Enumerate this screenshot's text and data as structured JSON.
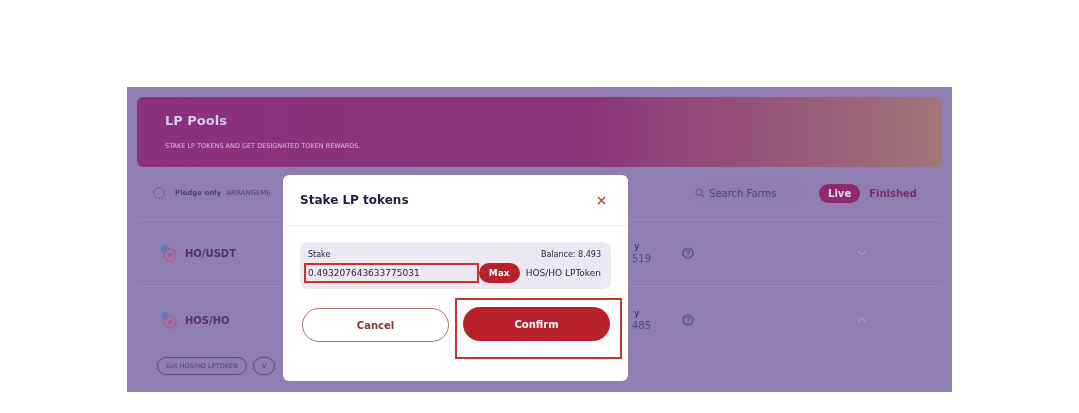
{
  "header": {
    "title": "LP Pools",
    "subtitle": "STAKE LP TOKENS AND GET DESIGNATED TOKEN REWARDS."
  },
  "filters": {
    "pledge_only": {
      "label": "Pledge only",
      "checked": false
    },
    "sort_label": "ARRANGEME",
    "search": {
      "placeholder": "Search Farms"
    },
    "tabs": [
      {
        "label": "Live",
        "selected": true
      },
      {
        "label": "Finished",
        "selected": false
      }
    ]
  },
  "pools": [
    {
      "pair": "HO/USDT",
      "column_3": {
        "label": "y",
        "value": "519"
      },
      "expanded": false
    },
    {
      "pair": "HOS/HO",
      "column_3": {
        "label": "y",
        "value": "485"
      },
      "expanded": true,
      "actions": [
        {
          "label": "Get HOS/HO LPTOKEN"
        },
        {
          "label": "V"
        }
      ]
    }
  ],
  "modal": {
    "title": "Stake LP tokens",
    "stake_label": "Stake",
    "balance": "Balance: 8.493",
    "amount": "0.493207643633775031",
    "amount_highlighted": true,
    "max_label": "Max",
    "token": "HOS/HO LPToken",
    "buttons": [
      {
        "label": "Cancel",
        "kind": "secondary",
        "highlighted": false
      },
      {
        "label": "Confirm",
        "kind": "primary",
        "highlighted": true
      }
    ]
  }
}
